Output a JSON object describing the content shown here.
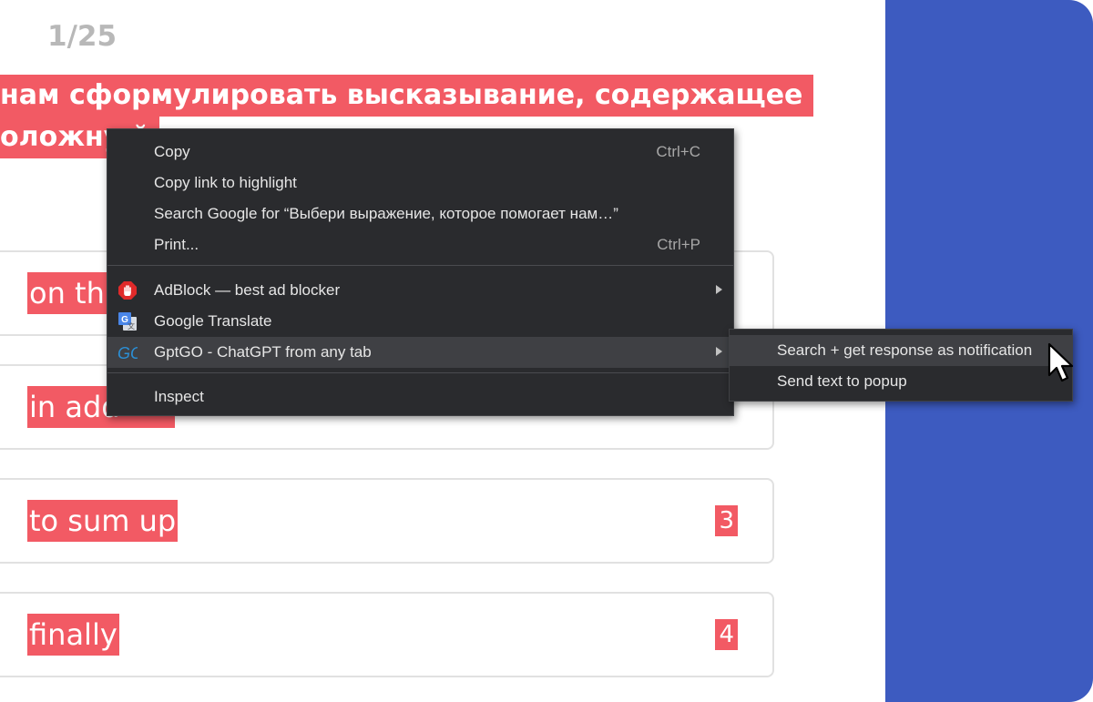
{
  "counter": "1/25",
  "question": {
    "line1": "нам сформулировать высказывание, содержащее",
    "line2": "оложну                       й"
  },
  "options": [
    {
      "text": "on th",
      "num": ""
    },
    {
      "text": "in add",
      "num": ""
    },
    {
      "text": "to sum up",
      "num": "3"
    },
    {
      "text": "finally",
      "num": "4"
    }
  ],
  "context_menu": {
    "copy": "Copy",
    "copy_shortcut": "Ctrl+C",
    "copy_link": "Copy link to highlight",
    "search_google": "Search Google for “Выбери выражение, которое помогает нам…”",
    "print": "Print...",
    "print_shortcut": "Ctrl+P",
    "adblock": "AdBlock — best ad blocker",
    "google_translate": "Google Translate",
    "gptgo": "GptGO - ChatGPT from any tab",
    "inspect": "Inspect"
  },
  "submenu": {
    "search_notification": "Search + get response as notification",
    "send_popup": "Send text to popup"
  },
  "colors": {
    "highlight": "#f25a64",
    "sidebar": "#3d5bc0",
    "menu_bg": "#2a2b2e"
  }
}
